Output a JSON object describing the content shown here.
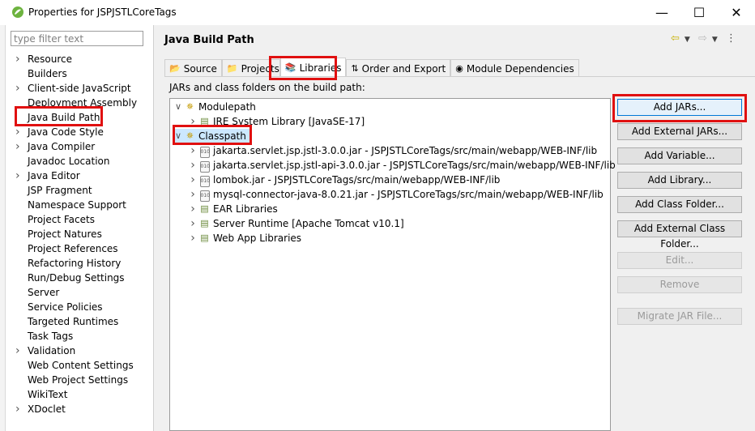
{
  "window": {
    "title": "Properties for JSPJSTLCoreTags",
    "minimize_icon": "minimize-icon",
    "maximize_icon": "maximize-icon",
    "close_icon": "close-icon"
  },
  "filter": {
    "placeholder": "type filter text",
    "value": ""
  },
  "nav": {
    "items": [
      {
        "label": "Resource",
        "expandable": true
      },
      {
        "label": "Builders",
        "expandable": false
      },
      {
        "label": "Client-side JavaScript",
        "expandable": true
      },
      {
        "label": "Deployment Assembly",
        "expandable": false
      },
      {
        "label": "Java Build Path",
        "expandable": false,
        "selected": true
      },
      {
        "label": "Java Code Style",
        "expandable": true
      },
      {
        "label": "Java Compiler",
        "expandable": true
      },
      {
        "label": "Javadoc Location",
        "expandable": false
      },
      {
        "label": "Java Editor",
        "expandable": true
      },
      {
        "label": "JSP Fragment",
        "expandable": false
      },
      {
        "label": "Namespace Support",
        "expandable": false
      },
      {
        "label": "Project Facets",
        "expandable": false
      },
      {
        "label": "Project Natures",
        "expandable": false
      },
      {
        "label": "Project References",
        "expandable": false
      },
      {
        "label": "Refactoring History",
        "expandable": false
      },
      {
        "label": "Run/Debug Settings",
        "expandable": false
      },
      {
        "label": "Server",
        "expandable": false
      },
      {
        "label": "Service Policies",
        "expandable": false
      },
      {
        "label": "Targeted Runtimes",
        "expandable": false
      },
      {
        "label": "Task Tags",
        "expandable": false
      },
      {
        "label": "Validation",
        "expandable": true
      },
      {
        "label": "Web Content Settings",
        "expandable": false
      },
      {
        "label": "Web Project Settings",
        "expandable": false
      },
      {
        "label": "WikiText",
        "expandable": false
      },
      {
        "label": "XDoclet",
        "expandable": true
      }
    ]
  },
  "page": {
    "title": "Java Build Path",
    "tabs": [
      {
        "label": "Source",
        "icon": "source-folder-icon"
      },
      {
        "label": "Projects",
        "icon": "projects-icon"
      },
      {
        "label": "Libraries",
        "icon": "libraries-icon",
        "active": true
      },
      {
        "label": "Order and Export",
        "icon": "order-export-icon"
      },
      {
        "label": "Module Dependencies",
        "icon": "module-dependencies-icon"
      }
    ],
    "jars_label": "JARs and class folders on the build path:",
    "tree": [
      {
        "label": "Modulepath",
        "level": 0,
        "expanded": true,
        "icon": "classpath-icon"
      },
      {
        "label": "JRE System Library [JavaSE-17]",
        "level": 1,
        "expanded": false,
        "icon": "library-icon"
      },
      {
        "label": "Classpath",
        "level": 0,
        "expanded": true,
        "icon": "classpath-icon"
      },
      {
        "label": "jakarta.servlet.jsp.jstl-3.0.0.jar - JSPJSTLCoreTags/src/main/webapp/WEB-INF/lib",
        "level": 1,
        "expanded": false,
        "icon": "jar-icon"
      },
      {
        "label": "jakarta.servlet.jsp.jstl-api-3.0.0.jar - JSPJSTLCoreTags/src/main/webapp/WEB-INF/lib",
        "level": 1,
        "expanded": false,
        "icon": "jar-icon"
      },
      {
        "label": "lombok.jar - JSPJSTLCoreTags/src/main/webapp/WEB-INF/lib",
        "level": 1,
        "expanded": false,
        "icon": "jar-icon"
      },
      {
        "label": "mysql-connector-java-8.0.21.jar - JSPJSTLCoreTags/src/main/webapp/WEB-INF/lib",
        "level": 1,
        "expanded": false,
        "icon": "jar-icon"
      },
      {
        "label": "EAR Libraries",
        "level": 1,
        "expanded": false,
        "icon": "library-icon"
      },
      {
        "label": "Server Runtime [Apache Tomcat v10.1]",
        "level": 1,
        "expanded": false,
        "icon": "library-icon"
      },
      {
        "label": "Web App Libraries",
        "level": 1,
        "expanded": false,
        "icon": "library-icon"
      }
    ],
    "buttons": [
      {
        "label": "Add JARs...",
        "enabled": true
      },
      {
        "label": "Add External JARs...",
        "enabled": true
      },
      {
        "label": "Add Variable...",
        "enabled": true
      },
      {
        "label": "Add Library...",
        "enabled": true
      },
      {
        "label": "Add Class Folder...",
        "enabled": true
      },
      {
        "label": "Add External Class Folder...",
        "enabled": true
      },
      {
        "label": "Edit...",
        "enabled": false
      },
      {
        "label": "Remove",
        "enabled": false
      },
      {
        "label": "Migrate JAR File...",
        "enabled": false
      }
    ]
  },
  "colors": {
    "highlight": "#e01010",
    "selection": "#cce8ff",
    "panel": "#f0f0f0"
  }
}
